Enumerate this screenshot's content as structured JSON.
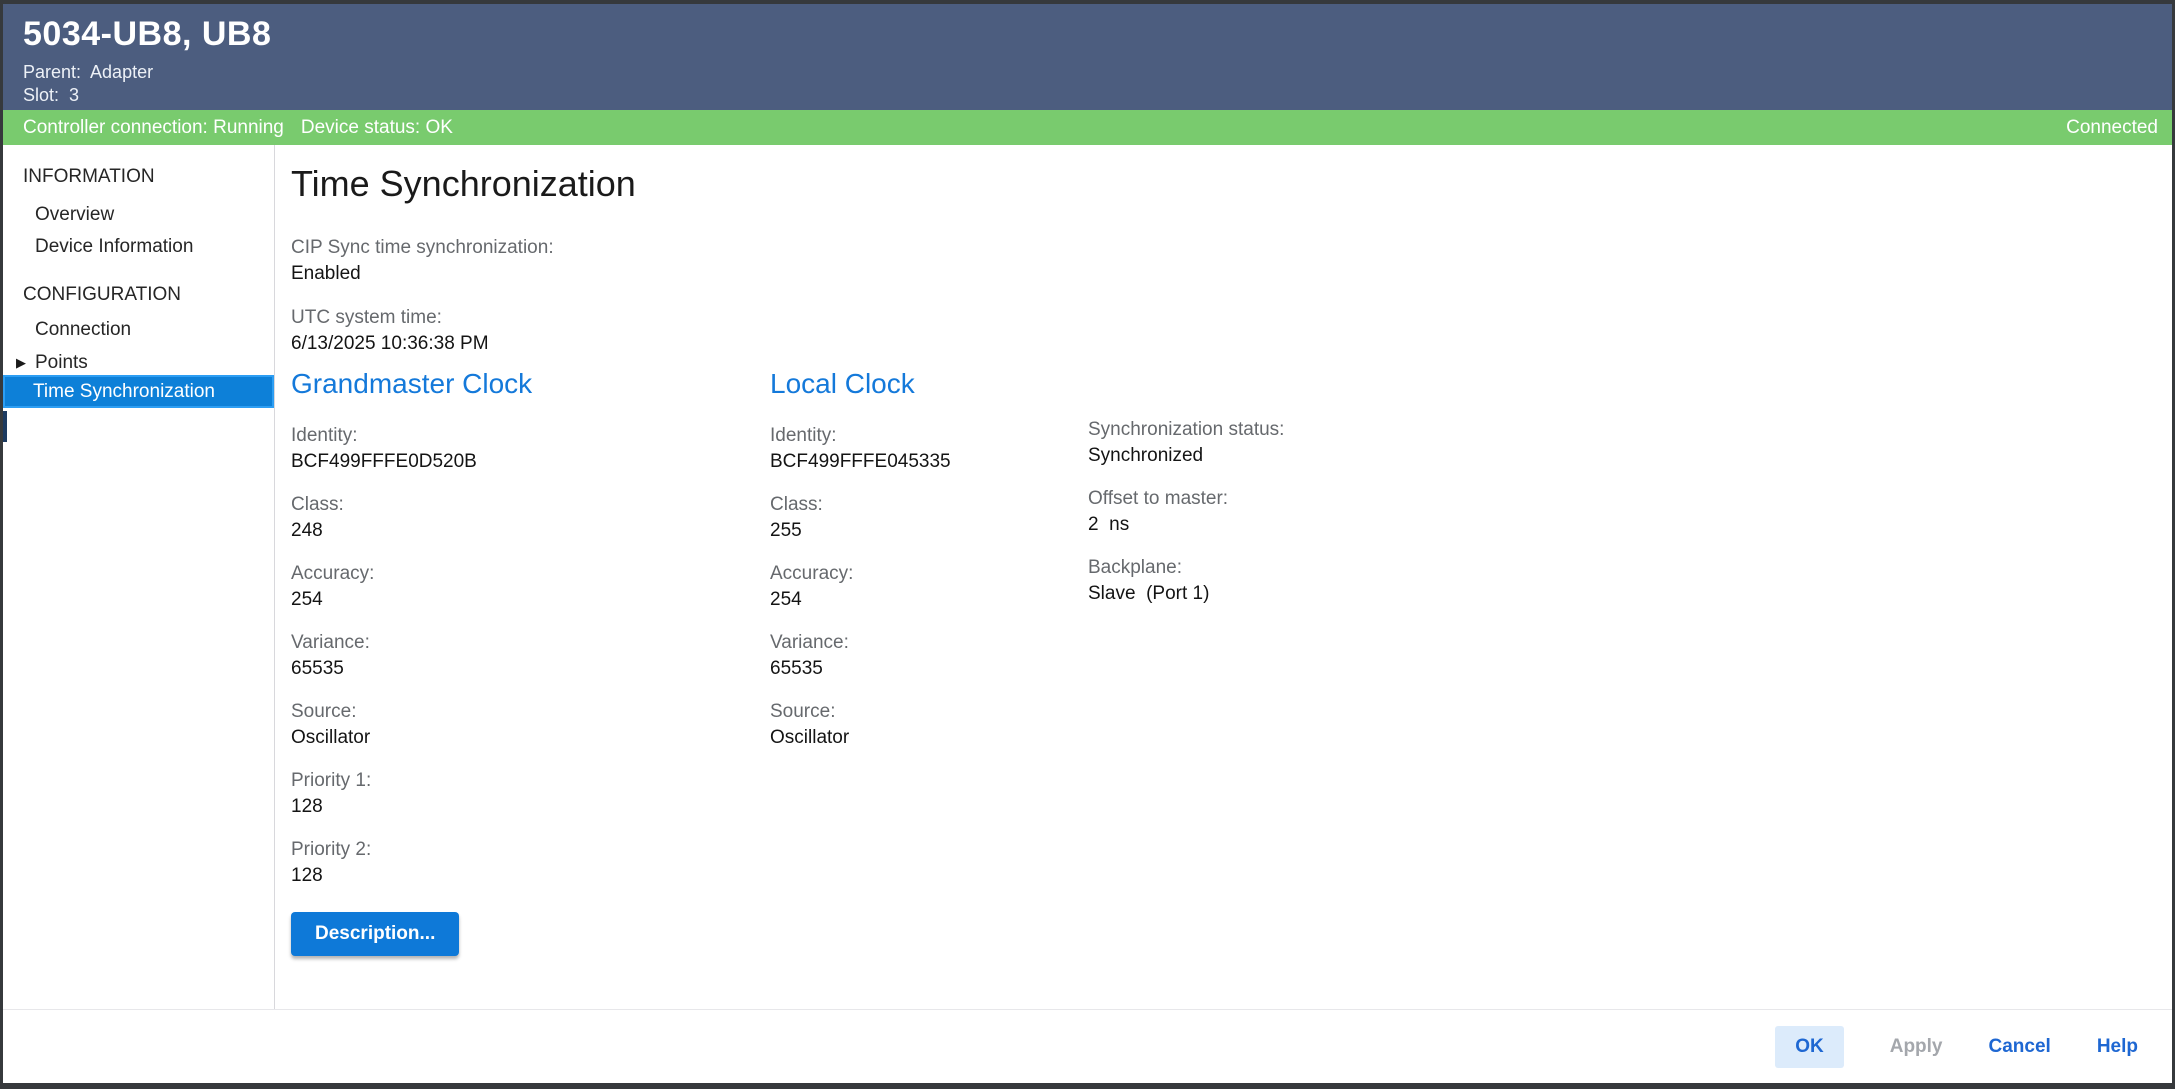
{
  "window": {
    "title": "5034-UB8, UB8",
    "parent": "Parent:  Adapter",
    "slot": "Slot:  3"
  },
  "status_bar": {
    "controller_connection": "Controller connection: Running",
    "device_status": "Device status: OK",
    "connection_state": "Connected"
  },
  "sidebar": {
    "section_information": "INFORMATION",
    "item_overview": "Overview",
    "item_device_information": "Device Information",
    "section_configuration": "CONFIGURATION",
    "item_connection": "Connection",
    "item_points": "Points",
    "points_expander_icon": "▶",
    "item_time_sync": "Time Synchronization"
  },
  "main": {
    "title": "Time Synchronization",
    "cip": {
      "label": "CIP Sync time synchronization:",
      "value": "Enabled"
    },
    "utc": {
      "label": "UTC system time:",
      "value": "6/13/2025 10:36:38 PM"
    },
    "grandmaster": {
      "heading": "Grandmaster Clock",
      "rows": [
        {
          "label": "Identity:",
          "value": "BCF499FFFE0D520B"
        },
        {
          "label": "Class:",
          "value": "248"
        },
        {
          "label": "Accuracy:",
          "value": "254"
        },
        {
          "label": "Variance:",
          "value": "65535"
        },
        {
          "label": "Source:",
          "value": "Oscillator"
        },
        {
          "label": "Priority 1:",
          "value": "128"
        },
        {
          "label": "Priority 2:",
          "value": "128"
        }
      ],
      "description_button": "Description..."
    },
    "local": {
      "heading": "Local Clock",
      "rows": [
        {
          "label": "Identity:",
          "value": "BCF499FFFE045335"
        },
        {
          "label": "Class:",
          "value": "255"
        },
        {
          "label": "Accuracy:",
          "value": "254"
        },
        {
          "label": "Variance:",
          "value": "65535"
        },
        {
          "label": "Source:",
          "value": "Oscillator"
        }
      ]
    },
    "status_col": {
      "rows": [
        {
          "label": "Synchronization status:",
          "value": "Synchronized"
        },
        {
          "label": "Offset to master:",
          "value": "2  ns"
        },
        {
          "label": "Backplane:",
          "value": "Slave  (Port 1)"
        }
      ]
    }
  },
  "footer": {
    "ok": "OK",
    "apply": "Apply",
    "cancel": "Cancel",
    "help": "Help"
  },
  "colors": {
    "header_bg": "#4c5d7f",
    "status_green": "#79cb6e",
    "selection_blue": "#0d80d8",
    "selection_border": "#2d9ef3",
    "heading_blue": "#1479da",
    "primary_button_blue": "#0e79d8",
    "link_blue": "#1e67d2",
    "disabled_gray": "#a4a7ac",
    "window_border": "#36393c"
  }
}
